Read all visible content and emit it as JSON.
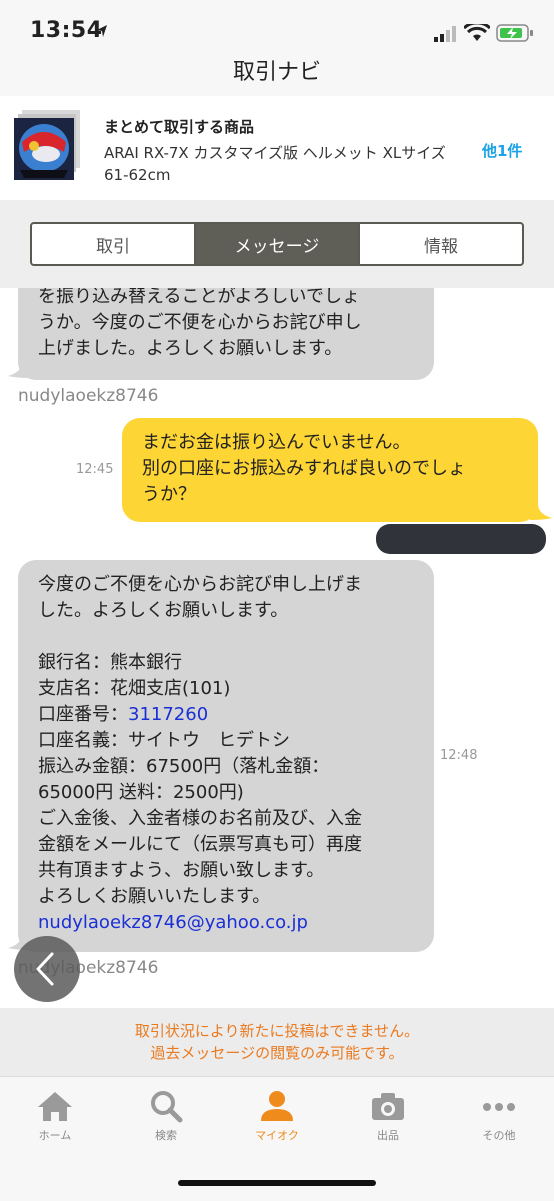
{
  "status_bar": {
    "time": "13:54"
  },
  "nav": {
    "title": "取引ナビ"
  },
  "item": {
    "title": "まとめて取引する商品",
    "description": "ARAI RX-7X カスタマイズ版 ヘルメット XLサイズ 61-62cm",
    "more": "他1件"
  },
  "tabs": [
    {
      "label": "取引",
      "active": false
    },
    {
      "label": "メッセージ",
      "active": true
    },
    {
      "label": "情報",
      "active": false
    }
  ],
  "messages": {
    "m1": {
      "lines": [
        "を振り込み替えることがよろしいでしょ",
        "うか。今度のご不便を心からお詫び申し",
        "上げました。よろしくお願いします。"
      ],
      "sender": "nudylaoekz8746"
    },
    "m2": {
      "lines": [
        "まだお金は振り込んでいません。",
        "別の口座にお振込みすれば良いのでしょ",
        "うか？"
      ],
      "time": "12:45"
    },
    "m3": {
      "lines": [
        "今度のご不便を心からお詫び申し上げま",
        "した。よろしくお願いします。",
        "",
        "銀行名：熊本銀行",
        "支店名：花畑支店(101)"
      ],
      "account_label": "口座番号：",
      "account_number": "3117260",
      "lines2": [
        "口座名義：サイトウ　ヒデトシ",
        "振込み金額：67500円（落札金額：",
        "65000円 送料：2500円)",
        "ご入金後、入金者様のお名前及び、入金",
        "金額をメールにて（伝票写真も可）再度",
        "共有頂ますよう、お願い致します。",
        "よろしくお願いいたします。"
      ],
      "email": "nudylaoekz8746@yahoo.co.jp",
      "time": "12:48",
      "sender": "nudylaoekz8746"
    }
  },
  "notice": {
    "line1": "取引状況により新たに投稿はできません。",
    "line2": "過去メッセージの閲覧のみ可能です。"
  },
  "tabbar": [
    {
      "label": "ホーム",
      "icon": "home-icon"
    },
    {
      "label": "検索",
      "icon": "search-icon"
    },
    {
      "label": "マイオク",
      "icon": "person-icon",
      "active": true
    },
    {
      "label": "出品",
      "icon": "camera-icon"
    },
    {
      "label": "その他",
      "icon": "more-icon"
    }
  ],
  "colors": {
    "accent": "#ef8a1c",
    "bubble_yellow": "#fdd535",
    "link": "#1aa3e8"
  }
}
